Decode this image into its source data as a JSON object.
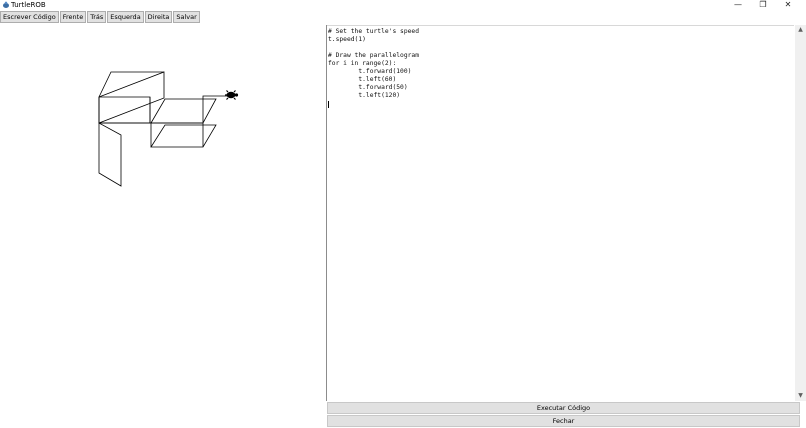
{
  "window": {
    "title": "TurtleROB",
    "minimize": "—",
    "maximize": "❐",
    "close": "✕"
  },
  "toolbar": {
    "buttons": [
      "Escrever Código",
      "Frente",
      "Trás",
      "Esquerda",
      "Direita",
      "Salvar"
    ]
  },
  "editor": {
    "lines": [
      "# Set the turtle's speed",
      "t.speed(1)",
      "",
      "# Draw the parallelogram",
      "for i in range(2):",
      "        t.forward(100)",
      "        t.left(60)",
      "        t.forward(50)",
      "        t.left(120)"
    ]
  },
  "scrollbar": {
    "up": "▲",
    "down": "▼"
  },
  "buttons": {
    "run": "Executar Código",
    "close": "Fechar"
  }
}
